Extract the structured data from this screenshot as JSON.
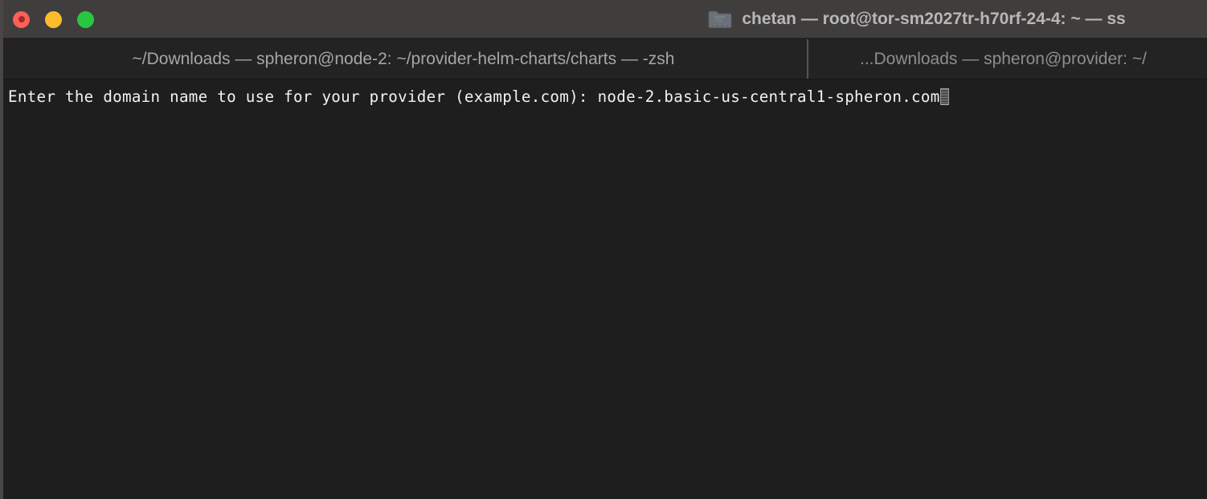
{
  "window": {
    "title": "chetan — root@tor-sm2027tr-h70rf-24-4: ~ — ss",
    "proxy_icon": "folder-icon",
    "chrome_color": "#403d3d",
    "body_color": "#1e1e1e"
  },
  "traffic_lights": {
    "close": {
      "name": "close-button",
      "color": "#ff5f57"
    },
    "minimize": {
      "name": "minimize-button",
      "color": "#fdbc2e"
    },
    "maximize": {
      "name": "maximize-button",
      "color": "#27c83f"
    }
  },
  "tabs": [
    {
      "label": "~/Downloads — spheron@node-2: ~/provider-helm-charts/charts — -zsh",
      "active": true
    },
    {
      "label": "...Downloads — spheron@provider: ~/",
      "active": false
    }
  ],
  "terminal": {
    "foreground": "#f2f2f2",
    "background": "#1e1e1e",
    "lines": [
      "Enter the domain name to use for your provider (example.com): node-2.basic-us-central1-spheron.com"
    ],
    "prompt_text": "Enter the domain name to use for your provider (example.com): ",
    "input_value": "node-2.basic-us-central1-spheron.com",
    "cursor": "block-outline"
  }
}
